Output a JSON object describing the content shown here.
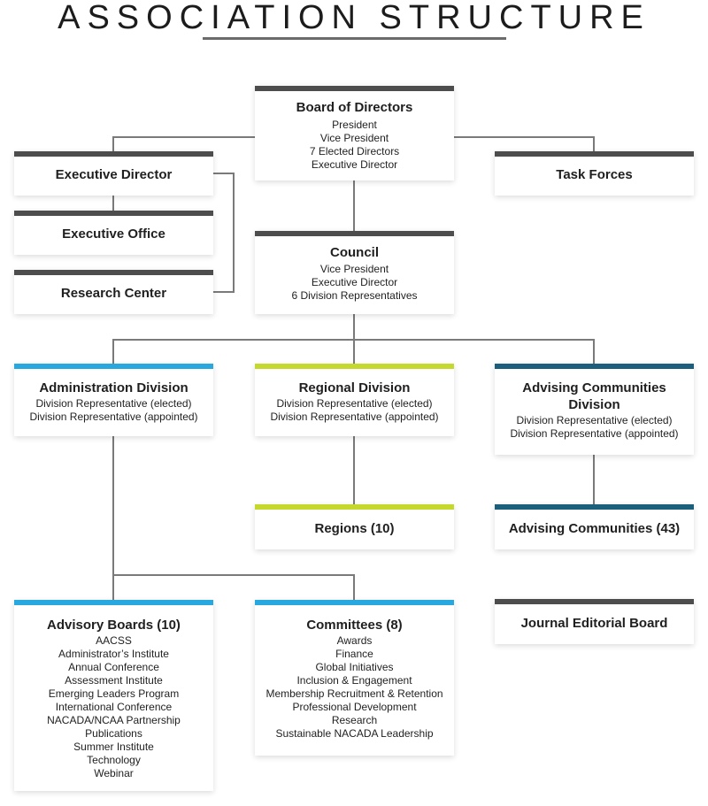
{
  "title": "ASSOCIATION STRUCTURE",
  "colors": {
    "dark": "#4d4d4d",
    "administration": "#29a8e0",
    "regional": "#c4d82e",
    "advising": "#1b5f7d",
    "connector": "#7a7a7a"
  },
  "nodes": {
    "board": {
      "title": "Board of Directors",
      "members": [
        "President",
        "Vice President",
        "7 Elected Directors",
        "Executive Director"
      ]
    },
    "executive_director": {
      "title": "Executive Director"
    },
    "executive_office": {
      "title": "Executive Office"
    },
    "research_center": {
      "title": "Research Center"
    },
    "task_forces": {
      "title": "Task Forces"
    },
    "council": {
      "title": "Council",
      "members": [
        "Vice President",
        "Executive Director",
        "6 Division Representatives"
      ]
    },
    "administration_division": {
      "title": "Administration Division",
      "members": [
        "Division Representative (elected)",
        "Division Representative (appointed)"
      ]
    },
    "regional_division": {
      "title": "Regional Division",
      "members": [
        "Division Representative (elected)",
        "Division Representative (appointed)"
      ]
    },
    "advising_division": {
      "title": "Advising Communities Division",
      "members": [
        "Division Representative (elected)",
        "Division Representative (appointed)"
      ]
    },
    "regions": {
      "title": "Regions (10)"
    },
    "advising_communities": {
      "title": "Advising Communities (43)"
    },
    "advisory_boards": {
      "title": "Advisory Boards (10)",
      "members": [
        "AACSS",
        "Administrator’s Institute",
        "Annual Conference",
        "Assessment Institute",
        "Emerging Leaders Program",
        "International Conference",
        "NACADA/NCAA Partnership",
        "Publications",
        "Summer Institute",
        "Technology",
        "Webinar"
      ]
    },
    "committees": {
      "title": "Committees (8)",
      "members": [
        "Awards",
        "Finance",
        "Global Initiatives",
        "Inclusion & Engagement",
        "Membership Recruitment & Retention",
        "Professional Development",
        "Research",
        "Sustainable NACADA Leadership"
      ]
    },
    "journal": {
      "title": "Journal Editorial Board"
    }
  }
}
